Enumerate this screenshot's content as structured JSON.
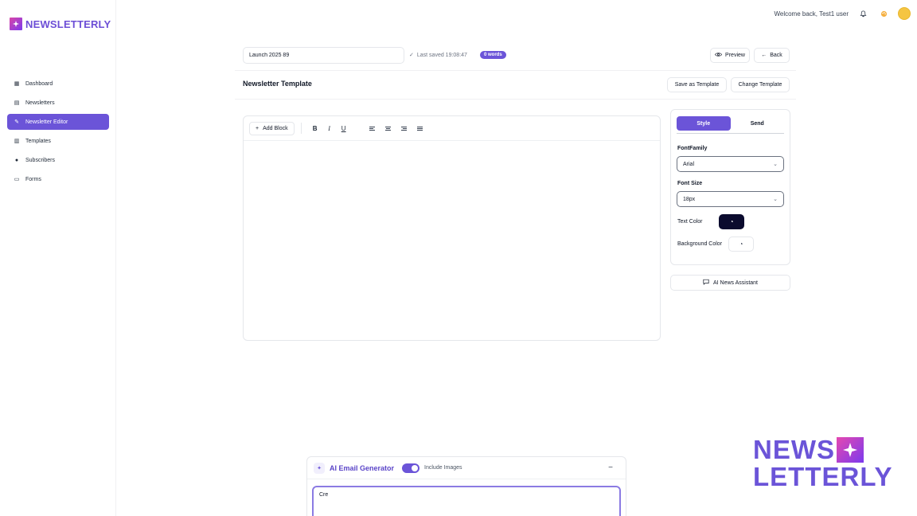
{
  "app": {
    "logo_text": "NEWSLETTERLY"
  },
  "sidebar": {
    "items": [
      {
        "label": "Dashboard",
        "icon": "dashboard-icon",
        "active": false
      },
      {
        "label": "Newsletters",
        "icon": "document-icon",
        "active": false
      },
      {
        "label": "Newsletter Editor",
        "icon": "edit-icon",
        "active": true
      },
      {
        "label": "Templates",
        "icon": "template-icon",
        "active": false
      },
      {
        "label": "Subscribers",
        "icon": "users-icon",
        "active": false
      },
      {
        "label": "Forms",
        "icon": "form-icon",
        "active": false
      }
    ]
  },
  "header": {
    "welcome": "Welcome back, Test1 user"
  },
  "toolbar": {
    "title_value": "Launch 2025 89",
    "last_saved": "Last saved 19:08:47",
    "words": "0 words",
    "preview_label": "Preview",
    "back_label": "Back"
  },
  "template_bar": {
    "title": "Newsletter Template",
    "save_template_label": "Save as Template",
    "change_template_label": "Change Template"
  },
  "editor": {
    "add_block_label": "Add Block",
    "bold": "B",
    "italic": "I",
    "underline": "U"
  },
  "style_panel": {
    "tabs": [
      "Style",
      "Send"
    ],
    "font_family_label": "FontFamily",
    "font_family_value": "Arial",
    "font_size_label": "Font Size",
    "font_size_value": "18px",
    "text_color_label": "Text Color",
    "text_color": "#0b0b2e",
    "background_color_label": "Background Color",
    "background_color": "#ffffff"
  },
  "ai_news_label": "AI News Assistant",
  "ai_generator": {
    "title": "AI Email Generator",
    "include_images_label": "Include Images",
    "include_images": true,
    "prompt_value": "Cre"
  },
  "watermark": {
    "line1": "NEWS",
    "line2": "LETTERLY"
  },
  "colors": {
    "accent": "#6b54d8"
  }
}
